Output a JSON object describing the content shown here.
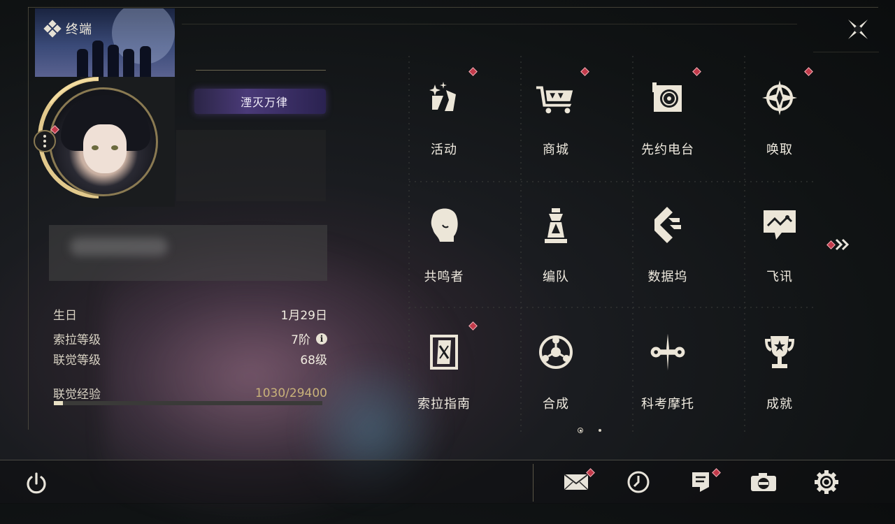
{
  "header": {
    "title": "终端"
  },
  "profile": {
    "title_badge": "湮灭万律",
    "info": [
      {
        "label": "生日",
        "value": "1月29日"
      },
      {
        "label": "索拉等级",
        "value": "7阶"
      },
      {
        "label": "联觉等级",
        "value": "68级"
      }
    ],
    "exp": {
      "label": "联觉经验",
      "value": "1030/29400",
      "fraction": 0.035
    }
  },
  "menu": [
    {
      "label": "活动",
      "icon": "activity-icon",
      "badge": true
    },
    {
      "label": "商城",
      "icon": "shop-icon",
      "badge": true
    },
    {
      "label": "先约电台",
      "icon": "radio-icon",
      "badge": true
    },
    {
      "label": "唤取",
      "icon": "summon-icon",
      "badge": true
    },
    {
      "label": "共鸣者",
      "icon": "resonator-icon",
      "badge": false
    },
    {
      "label": "编队",
      "icon": "team-icon",
      "badge": false
    },
    {
      "label": "数据坞",
      "icon": "data-bank-icon",
      "badge": false
    },
    {
      "label": "飞讯",
      "icon": "message-icon",
      "badge": false
    },
    {
      "label": "索拉指南",
      "icon": "guidebook-icon",
      "badge": true
    },
    {
      "label": "合成",
      "icon": "synthesis-icon",
      "badge": false
    },
    {
      "label": "科考摩托",
      "icon": "motorcycle-icon",
      "badge": false
    },
    {
      "label": "成就",
      "icon": "trophy-icon",
      "badge": false
    }
  ],
  "pager": {
    "current": 1,
    "total": 2
  },
  "bottom_bar": [
    "mail-icon",
    "clock-icon",
    "notice-icon",
    "camera-icon",
    "settings-icon"
  ],
  "colors": {
    "accent_gold": "#8a7a52",
    "badge_red": "#c23a4a",
    "text": "#f0ebe0"
  }
}
